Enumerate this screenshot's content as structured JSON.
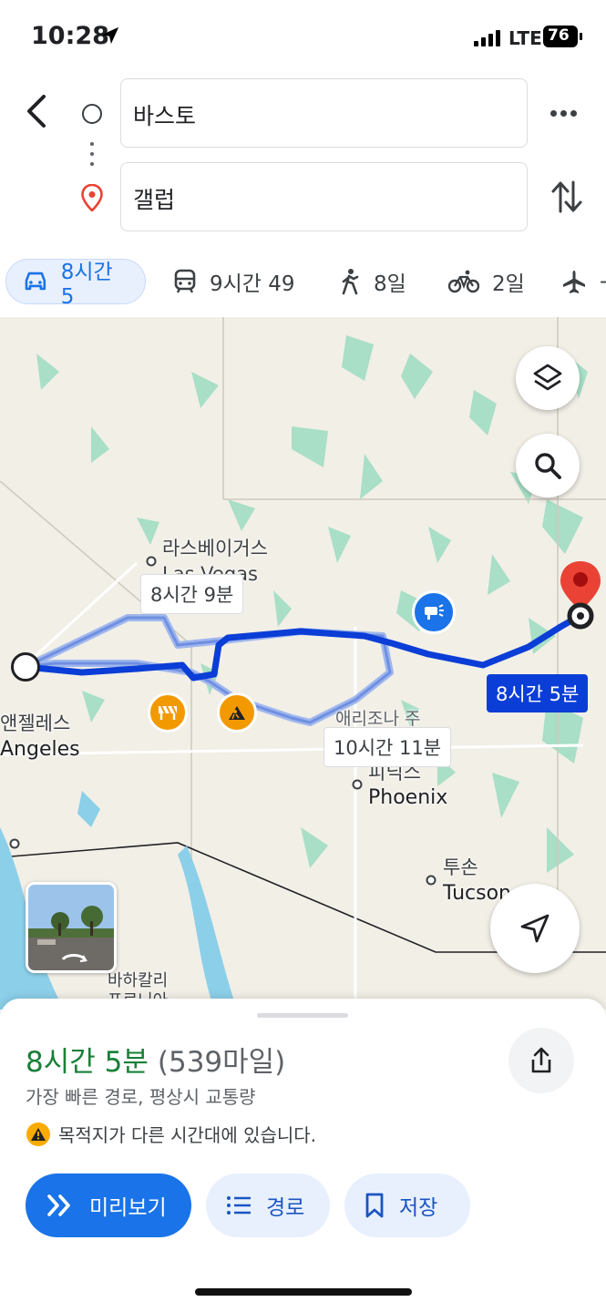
{
  "status_bar": {
    "time": "10:28",
    "network": "LTE",
    "battery": "76"
  },
  "search": {
    "origin": "바스토",
    "destination": "갤럽"
  },
  "modes": [
    {
      "icon": "car-icon",
      "label": "8시간 5"
    },
    {
      "icon": "transit-icon",
      "label": "9시간 49"
    },
    {
      "icon": "walk-icon",
      "label": "8일"
    },
    {
      "icon": "bike-icon",
      "label": "2일"
    },
    {
      "icon": "plane-icon",
      "label": "-"
    }
  ],
  "map": {
    "places": {
      "las_vegas_ko": "라스베이거스",
      "las_vegas_en": "Las Vegas",
      "la_ko": "앤젤레스",
      "la_en": "Angeles",
      "arizona": "애리조나 주",
      "phoenix_ko": "피닉스",
      "phoenix_en": "Phoenix",
      "tucson_ko": "투손",
      "tucson_en": "Tucson",
      "baja": "바하칼리포르니아"
    },
    "routes": {
      "main": "8시간 5분",
      "alt1": "8시간 9분",
      "alt2": "10시간 11분"
    }
  },
  "sheet": {
    "duration": "8시간 5분",
    "distance": "(539마일)",
    "subtitle": "가장 빠른 경로, 평상시 교통량",
    "warning": "목적지가 다른 시간대에 있습니다.",
    "buttons": {
      "preview": "미리보기",
      "steps": "경로",
      "save": "저장"
    }
  },
  "colors": {
    "accent": "#1a73e8",
    "route": "#0b3ed6",
    "green": "#188038",
    "pin": "#ea4335"
  }
}
